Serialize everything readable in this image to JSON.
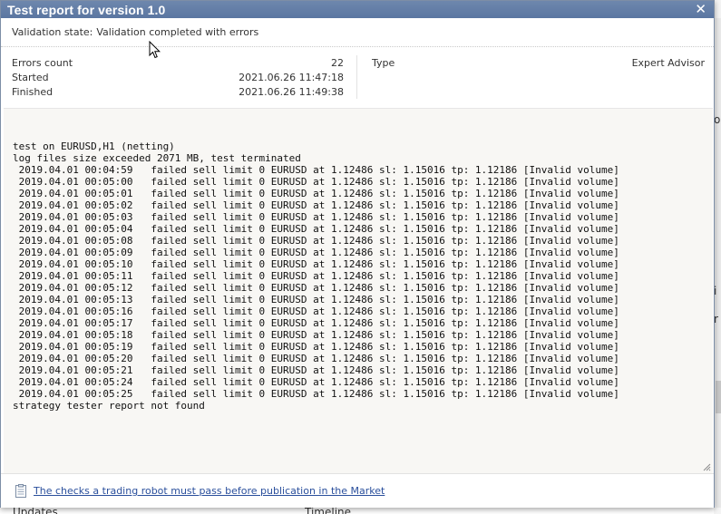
{
  "dialog": {
    "title": "Test report for version 1.0",
    "close_glyph": "✕"
  },
  "validation": {
    "label": "Validation state:",
    "value": "Validation completed with errors"
  },
  "stats": {
    "errors_label": "Errors count",
    "errors_value": "22",
    "started_label": "Started",
    "started_value": "2021.06.26 11:47:18",
    "finished_label": "Finished",
    "finished_value": "2021.06.26 11:49:38",
    "type_label": "Type",
    "type_value": "Expert Advisor"
  },
  "log": {
    "lines": [
      "test on EURUSD,H1 (netting)",
      "log files size exceeded 2071 MB, test terminated",
      " 2019.04.01 00:04:59   failed sell limit 0 EURUSD at 1.12486 sl: 1.15016 tp: 1.12186 [Invalid volume]",
      " 2019.04.01 00:05:00   failed sell limit 0 EURUSD at 1.12486 sl: 1.15016 tp: 1.12186 [Invalid volume]",
      " 2019.04.01 00:05:01   failed sell limit 0 EURUSD at 1.12486 sl: 1.15016 tp: 1.12186 [Invalid volume]",
      " 2019.04.01 00:05:02   failed sell limit 0 EURUSD at 1.12486 sl: 1.15016 tp: 1.12186 [Invalid volume]",
      " 2019.04.01 00:05:03   failed sell limit 0 EURUSD at 1.12486 sl: 1.15016 tp: 1.12186 [Invalid volume]",
      " 2019.04.01 00:05:04   failed sell limit 0 EURUSD at 1.12486 sl: 1.15016 tp: 1.12186 [Invalid volume]",
      " 2019.04.01 00:05:08   failed sell limit 0 EURUSD at 1.12486 sl: 1.15016 tp: 1.12186 [Invalid volume]",
      " 2019.04.01 00:05:09   failed sell limit 0 EURUSD at 1.12486 sl: 1.15016 tp: 1.12186 [Invalid volume]",
      " 2019.04.01 00:05:10   failed sell limit 0 EURUSD at 1.12486 sl: 1.15016 tp: 1.12186 [Invalid volume]",
      " 2019.04.01 00:05:11   failed sell limit 0 EURUSD at 1.12486 sl: 1.15016 tp: 1.12186 [Invalid volume]",
      " 2019.04.01 00:05:12   failed sell limit 0 EURUSD at 1.12486 sl: 1.15016 tp: 1.12186 [Invalid volume]",
      " 2019.04.01 00:05:13   failed sell limit 0 EURUSD at 1.12486 sl: 1.15016 tp: 1.12186 [Invalid volume]",
      " 2019.04.01 00:05:16   failed sell limit 0 EURUSD at 1.12486 sl: 1.15016 tp: 1.12186 [Invalid volume]",
      " 2019.04.01 00:05:17   failed sell limit 0 EURUSD at 1.12486 sl: 1.15016 tp: 1.12186 [Invalid volume]",
      " 2019.04.01 00:05:18   failed sell limit 0 EURUSD at 1.12486 sl: 1.15016 tp: 1.12186 [Invalid volume]",
      " 2019.04.01 00:05:19   failed sell limit 0 EURUSD at 1.12486 sl: 1.15016 tp: 1.12186 [Invalid volume]",
      " 2019.04.01 00:05:20   failed sell limit 0 EURUSD at 1.12486 sl: 1.15016 tp: 1.12186 [Invalid volume]",
      " 2019.04.01 00:05:21   failed sell limit 0 EURUSD at 1.12486 sl: 1.15016 tp: 1.12186 [Invalid volume]",
      " 2019.04.01 00:05:24   failed sell limit 0 EURUSD at 1.12486 sl: 1.15016 tp: 1.12186 [Invalid volume]",
      " 2019.04.01 00:05:25   failed sell limit 0 EURUSD at 1.12486 sl: 1.15016 tp: 1.12186 [Invalid volume]",
      "strategy tester report not found"
    ]
  },
  "footer": {
    "icon": "clipboard-icon",
    "link_text": "The checks a trading robot must pass before publication in the Market"
  },
  "background": {
    "bottom_left_text": "Updates",
    "bottom_mid_text": "Timeline",
    "right_glyphs": [
      "o",
      "i",
      "r"
    ]
  },
  "colors": {
    "titlebar": "#5a76a1",
    "log_background": "#f8f7f4",
    "link": "#2a4f9c"
  }
}
